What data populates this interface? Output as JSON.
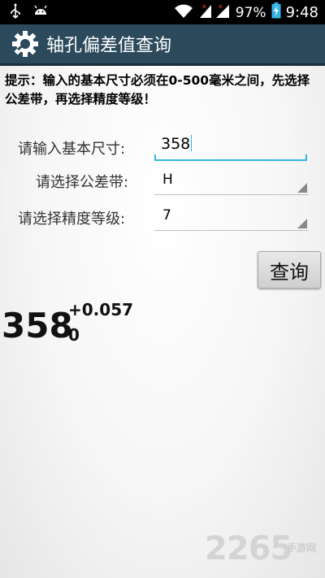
{
  "status_bar": {
    "battery": "97%",
    "time": "9:48",
    "icons": [
      "usb-icon",
      "android-debug-icon",
      "wifi-icon",
      "signal-icon",
      "battery-charging-icon"
    ]
  },
  "app": {
    "title": "轴孔偏差值查询",
    "icon": "gear-icon",
    "accent": "#33b5e5",
    "actionbar_color": "#2c4a5b"
  },
  "hint": {
    "text": "提示：输入的基本尺寸必须在0-500毫米之间，先选择公差带，再选择精度等级！"
  },
  "form": {
    "size_label": "请输入基本尺寸:",
    "size_value": "358",
    "tolerance_label": "请选择公差带:",
    "tolerance_value": "H",
    "grade_label": "请选择精度等级:",
    "grade_value": "7"
  },
  "query_button": "查询",
  "result": {
    "base": "358",
    "upper": "+0.057",
    "lower": "0"
  },
  "watermark": {
    "big": "2265",
    "small": "手游网"
  }
}
